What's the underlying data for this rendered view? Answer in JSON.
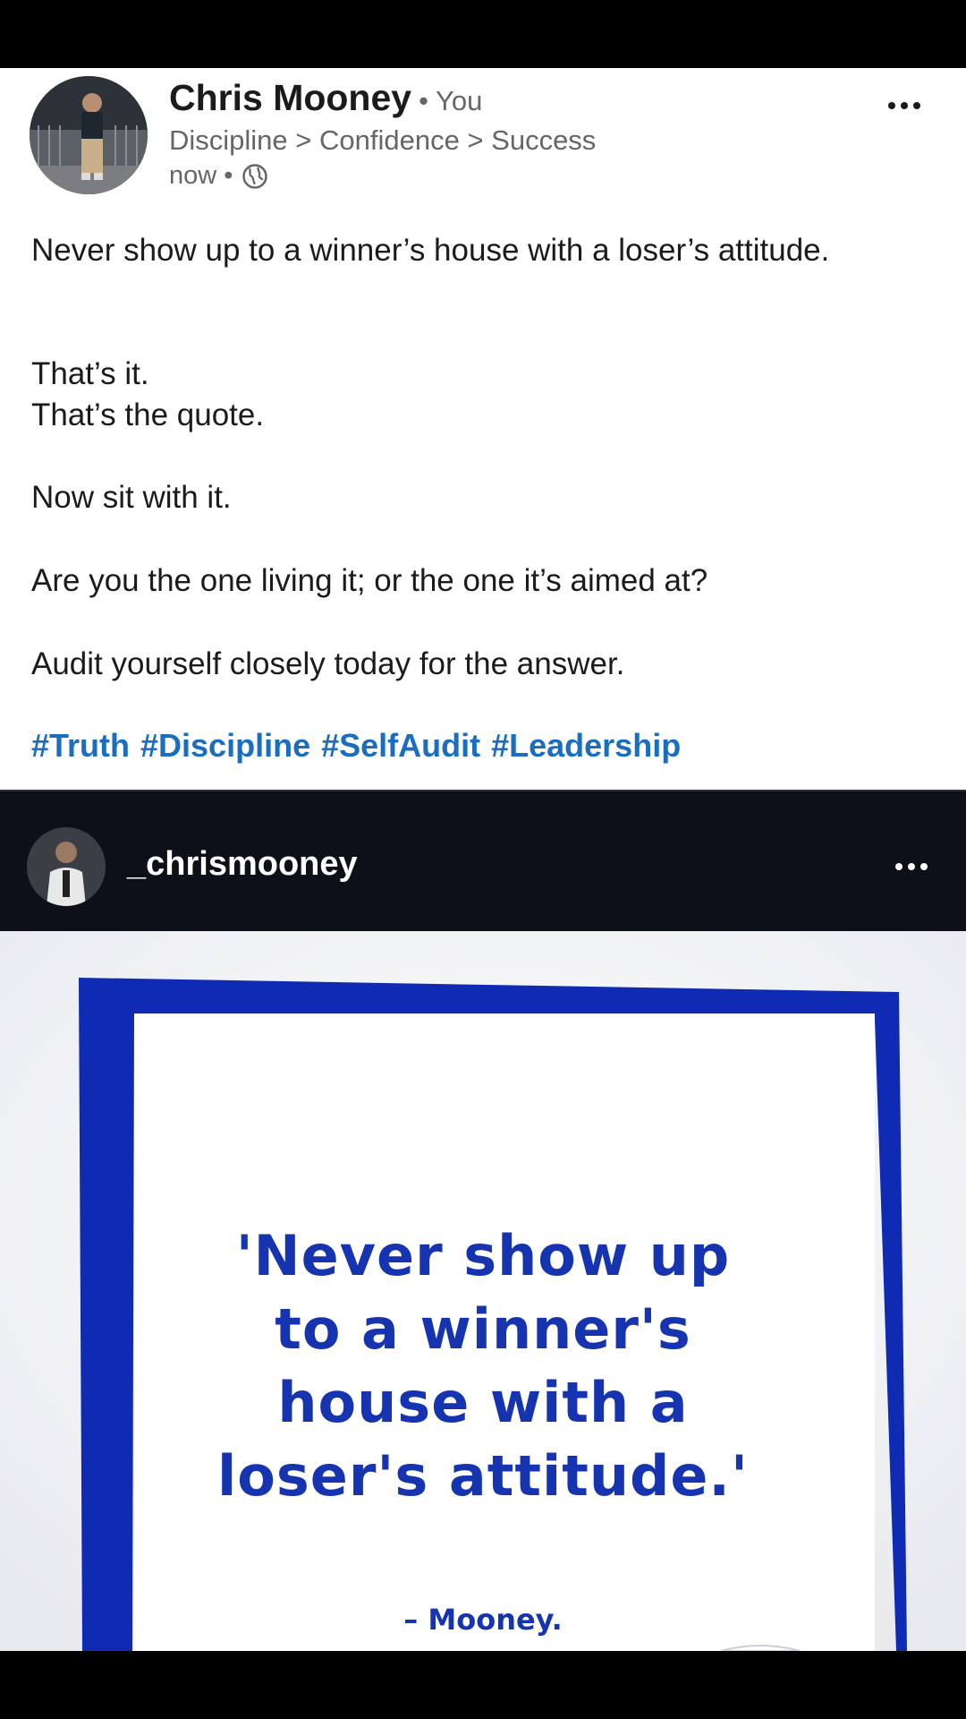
{
  "post": {
    "author": "Chris Mooney",
    "author_suffix": "• You",
    "headline": "Discipline > Confidence > Success",
    "time": "now •",
    "paragraphs": [
      "Never show up to a winner’s house with a loser’s attitude.",
      "That’s it.",
      "That’s the quote.",
      "Now sit with it.",
      "Are you the one living it; or the one it’s aimed at?",
      "Audit yourself closely today for the answer."
    ],
    "hashtags": [
      "#Truth",
      "#Discipline",
      "#SelfAudit",
      "#Leadership"
    ]
  },
  "embed": {
    "username": "_chrismooney",
    "quote_lines": [
      "'Never show up",
      "to a winner's",
      "house with a",
      "loser's attitude.'"
    ],
    "quote_author": "– Mooney."
  },
  "colors": {
    "hashtag": "#1a6dbf",
    "quote_blue": "#1634b0",
    "frame_blue": "#0f2bb3"
  },
  "icons": [
    "globe-icon",
    "more-options-icon"
  ]
}
